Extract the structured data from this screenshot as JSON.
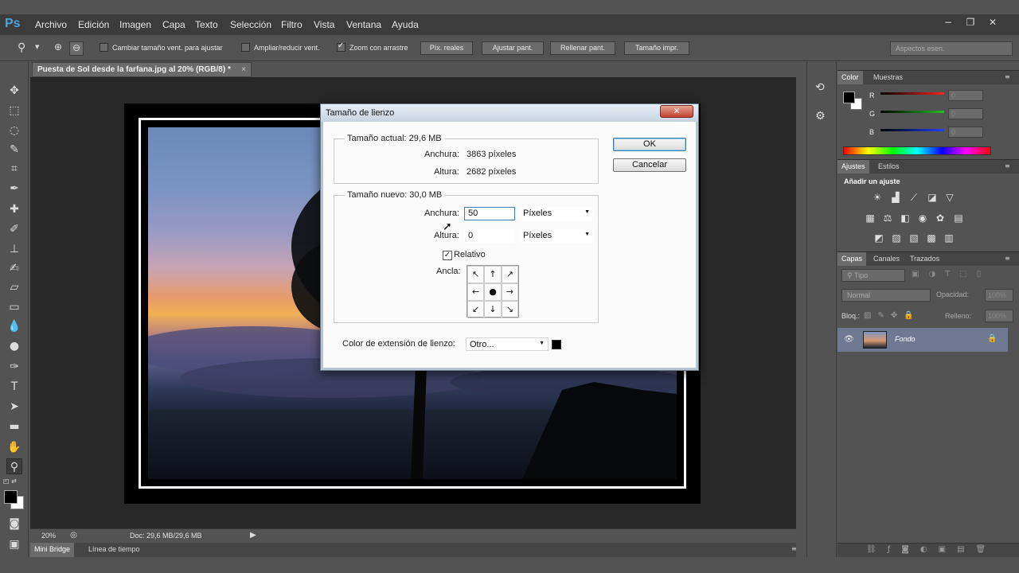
{
  "menubar": {
    "logo": "Ps",
    "items": [
      "Archivo",
      "Edición",
      "Imagen",
      "Capa",
      "Texto",
      "Selección",
      "Filtro",
      "Vista",
      "Ventana",
      "Ayuda"
    ]
  },
  "options": {
    "zoom_tool_icon": "zoom-icon",
    "chk_resize_windows": "Cambiar tamaño vent. para ajustar",
    "chk_zoom_all": "Ampliar/reducir vent.",
    "chk_scrubby_zoom": "Zoom con arrastre",
    "btn_actual_pixels": "Píx. reales",
    "btn_fit_screen": "Ajustar pant.",
    "btn_fill_screen": "Rellenar pant.",
    "btn_print_size": "Tamaño impr.",
    "workspace": "Aspectos esen."
  },
  "document": {
    "tab_title": "Puesta de Sol desde la farfana.jpg al 20% (RGB/8) *",
    "zoom": "20%",
    "doc_info": "Doc: 29,6 MB/29,6 MB"
  },
  "bottom_tabs": [
    "Mini Bridge",
    "Línea de tiempo"
  ],
  "color_panel": {
    "tabs": [
      "Color",
      "Muestras"
    ],
    "channels": [
      {
        "label": "R",
        "value": "0",
        "color": "#ff2020"
      },
      {
        "label": "G",
        "value": "0",
        "color": "#20c020"
      },
      {
        "label": "B",
        "value": "0",
        "color": "#2040ff"
      }
    ]
  },
  "adjust_panel": {
    "tabs": [
      "Ajustes",
      "Estilos"
    ],
    "heading": "Añadir un ajuste"
  },
  "layers_panel": {
    "tabs": [
      "Capas",
      "Canales",
      "Trazados"
    ],
    "filter_kind": "Tipo",
    "blend_mode": "Normal",
    "opacity_label": "Opacidad:",
    "opacity_value": "100%",
    "lock_label": "Bloq.:",
    "fill_label": "Relleno:",
    "fill_value": "100%",
    "layer_name": "Fondo"
  },
  "dialog": {
    "title": "Tamaño de lienzo",
    "current_size_label": "Tamaño actual: 29,6 MB",
    "current_width_label": "Anchura:",
    "current_width_value": "3863 píxeles",
    "current_height_label": "Altura:",
    "current_height_value": "2682 píxeles",
    "new_size_label": "Tamaño nuevo: 30,0 MB",
    "new_width_label": "Anchura:",
    "new_width_value": "50",
    "new_height_label": "Altura:",
    "new_height_value": "0",
    "unit_width": "Píxeles",
    "unit_height": "Píxeles",
    "relative_label": "Relativo",
    "anchor_label": "Ancla:",
    "extension_color_label": "Color de extensión de lienzo:",
    "extension_color_value": "Otro...",
    "ok": "OK",
    "cancel": "Cancelar"
  }
}
